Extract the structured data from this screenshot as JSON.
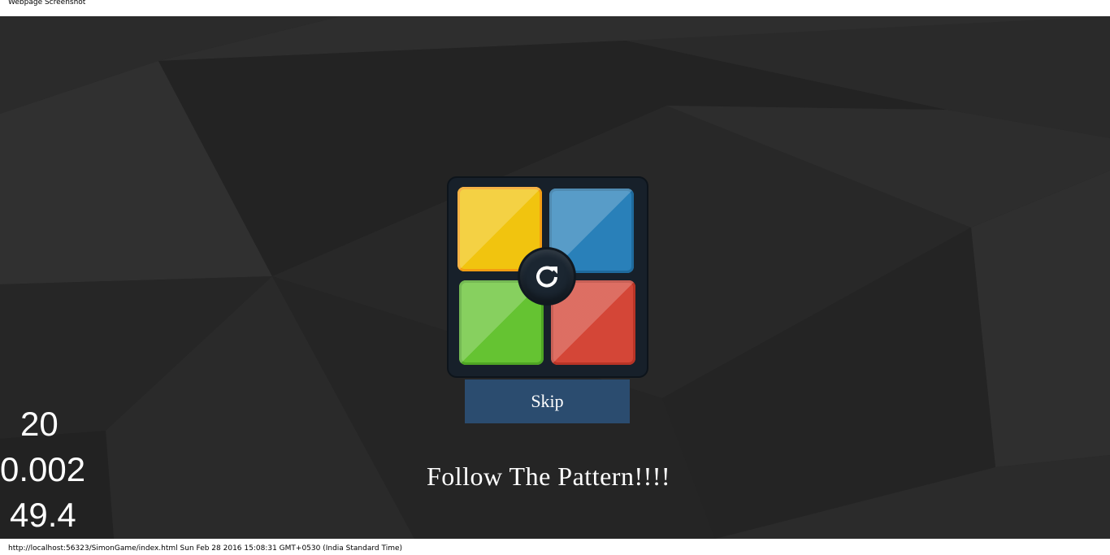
{
  "window": {
    "title": "Webpage Screenshot"
  },
  "game": {
    "pads": {
      "yellow": "#f1c40f",
      "blue": "#2980b9",
      "green": "#65c332",
      "red": "#d44637"
    },
    "center_icon": "refresh-icon",
    "skip_label": "Skip",
    "message": "Follow The Pattern!!!!"
  },
  "stats": {
    "value1": "20",
    "value2": "0.002",
    "value3": "49.4"
  },
  "footer": {
    "url_line": "http://localhost:56323/SimonGame/index.html Sun Feb 28 2016 15:08:31 GMT+0530 (India Standard Time)"
  }
}
